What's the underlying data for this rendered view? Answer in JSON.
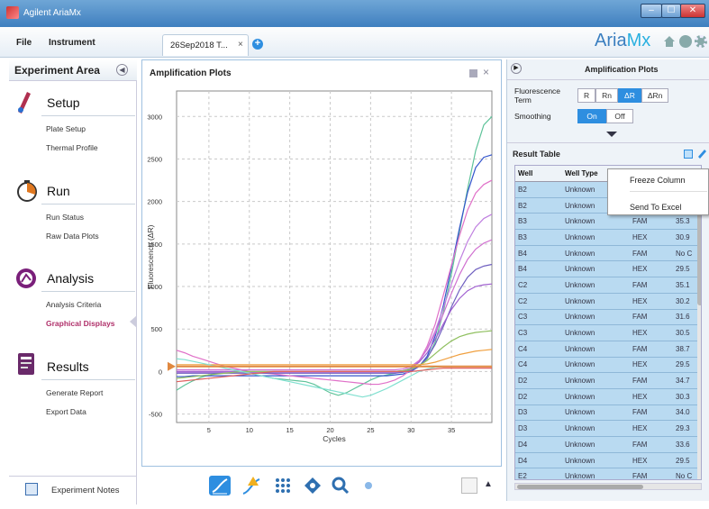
{
  "window": {
    "title": "Agilent AriaMx",
    "min": "–",
    "max": "☐",
    "close": "✕"
  },
  "menu": {
    "file": "File",
    "instrument": "Instrument"
  },
  "tab": {
    "label": "26Sep2018 T...",
    "close": "×",
    "add": "+"
  },
  "brand": {
    "aria": "Aria",
    "mx": "Mx"
  },
  "sidebar": {
    "title": "Experiment Area",
    "sections": [
      {
        "title": "Setup",
        "items": [
          "Plate Setup",
          "Thermal Profile"
        ]
      },
      {
        "title": "Run",
        "items": [
          "Run Status",
          "Raw Data Plots"
        ]
      },
      {
        "title": "Analysis",
        "items": [
          "Analysis Criteria",
          "Graphical Displays"
        ]
      },
      {
        "title": "Results",
        "items": [
          "Generate Report",
          "Export Data"
        ]
      }
    ],
    "notes": "Experiment Notes"
  },
  "chart_panel": {
    "title": "Amplification Plots"
  },
  "right_panel": {
    "title": "Amplification Plots",
    "fluor_label": "Fluorescence Term",
    "fluor_options": [
      "R",
      "Rn",
      "ΔR",
      "ΔRn"
    ],
    "fluor_selected": "ΔR",
    "smooth_label": "Smoothing",
    "smooth_options": [
      "On",
      "Off"
    ],
    "smooth_selected": "On",
    "result_table_title": "Result Table",
    "columns": [
      "Well",
      "Well Type",
      "",
      ""
    ],
    "rows": [
      [
        "B2",
        "Unknown",
        "",
        ""
      ],
      [
        "B2",
        "Unknown",
        "",
        ""
      ],
      [
        "B3",
        "Unknown",
        "FAM",
        "35.3"
      ],
      [
        "B3",
        "Unknown",
        "HEX",
        "30.9"
      ],
      [
        "B4",
        "Unknown",
        "FAM",
        "No C"
      ],
      [
        "B4",
        "Unknown",
        "HEX",
        "29.5"
      ],
      [
        "C2",
        "Unknown",
        "FAM",
        "35.1"
      ],
      [
        "C2",
        "Unknown",
        "HEX",
        "30.2"
      ],
      [
        "C3",
        "Unknown",
        "FAM",
        "31.6"
      ],
      [
        "C3",
        "Unknown",
        "HEX",
        "30.5"
      ],
      [
        "C4",
        "Unknown",
        "FAM",
        "38.7"
      ],
      [
        "C4",
        "Unknown",
        "HEX",
        "29.5"
      ],
      [
        "D2",
        "Unknown",
        "FAM",
        "34.7"
      ],
      [
        "D2",
        "Unknown",
        "HEX",
        "30.3"
      ],
      [
        "D3",
        "Unknown",
        "FAM",
        "34.0"
      ],
      [
        "D3",
        "Unknown",
        "HEX",
        "29.3"
      ],
      [
        "D4",
        "Unknown",
        "FAM",
        "33.6"
      ],
      [
        "D4",
        "Unknown",
        "HEX",
        "29.5"
      ],
      [
        "E2",
        "Unknown",
        "FAM",
        "No C"
      ]
    ]
  },
  "context_menu": {
    "items": [
      "Freeze Column",
      "Send To Excel"
    ]
  },
  "chart_data": {
    "type": "line",
    "xlabel": "Cycles",
    "ylabel": "Fluorescence (ΔR)",
    "xlim": [
      1,
      40
    ],
    "ylim": [
      -600,
      3300
    ],
    "xticks": [
      5,
      10,
      15,
      20,
      25,
      30,
      35
    ],
    "yticks": [
      -500,
      0,
      500,
      1000,
      1500,
      2000,
      2500,
      3000
    ],
    "grid": true,
    "series": [
      {
        "color": "#5fc39a",
        "values": [
          -220,
          -160,
          -110,
          -70,
          -40,
          -20,
          -10,
          0,
          0,
          -20,
          -40,
          -60,
          -80,
          -90,
          -100,
          -110,
          -120,
          -150,
          -200,
          -250,
          -280,
          -250,
          -200,
          -150,
          -100,
          -60,
          -40,
          -20,
          0,
          20,
          60,
          150,
          350,
          700,
          1150,
          1650,
          2150,
          2600,
          2900,
          3000
        ]
      },
      {
        "color": "#3355cc",
        "values": [
          -60,
          -60,
          -50,
          -50,
          -50,
          -50,
          -50,
          -50,
          -50,
          -50,
          -50,
          -50,
          -50,
          -50,
          -50,
          -50,
          -50,
          -50,
          -50,
          -50,
          -50,
          -50,
          -50,
          -50,
          -50,
          -50,
          -50,
          -40,
          -30,
          0,
          60,
          180,
          420,
          780,
          1230,
          1690,
          2110,
          2400,
          2520,
          2550
        ]
      },
      {
        "color": "#e070c8",
        "values": [
          250,
          220,
          180,
          150,
          120,
          90,
          60,
          40,
          20,
          0,
          -10,
          -20,
          -30,
          -40,
          -50,
          -60,
          -70,
          -80,
          -90,
          -100,
          -110,
          -120,
          -130,
          -140,
          -150,
          -150,
          -130,
          -100,
          -50,
          20,
          120,
          300,
          560,
          900,
          1250,
          1600,
          1900,
          2100,
          2200,
          2250
        ]
      },
      {
        "color": "#c080e0",
        "values": [
          -10,
          -10,
          -10,
          -10,
          -10,
          -10,
          -10,
          -10,
          -10,
          -10,
          -10,
          -10,
          -10,
          -10,
          -10,
          -10,
          -10,
          -10,
          -10,
          -10,
          -10,
          -10,
          -10,
          -10,
          -10,
          -10,
          -10,
          -10,
          0,
          40,
          120,
          270,
          480,
          750,
          1030,
          1300,
          1530,
          1700,
          1800,
          1850
        ]
      },
      {
        "color": "#d070d0",
        "values": [
          20,
          20,
          20,
          20,
          20,
          20,
          20,
          20,
          20,
          20,
          20,
          20,
          20,
          20,
          20,
          20,
          20,
          20,
          20,
          20,
          20,
          20,
          20,
          20,
          20,
          20,
          20,
          20,
          30,
          60,
          130,
          260,
          450,
          680,
          920,
          1140,
          1320,
          1440,
          1510,
          1550
        ]
      },
      {
        "color": "#7060c0",
        "values": [
          -20,
          -20,
          -20,
          -20,
          -20,
          -20,
          -20,
          -20,
          -20,
          -20,
          -20,
          -20,
          -20,
          -20,
          -20,
          -20,
          -20,
          -20,
          -20,
          -20,
          -20,
          -20,
          -20,
          -20,
          -20,
          -20,
          -20,
          -20,
          -10,
          10,
          60,
          160,
          320,
          530,
          760,
          960,
          1110,
          1200,
          1240,
          1260
        ]
      },
      {
        "color": "#a060d0",
        "values": [
          0,
          0,
          0,
          0,
          0,
          0,
          0,
          0,
          0,
          0,
          0,
          0,
          0,
          0,
          0,
          0,
          0,
          0,
          0,
          0,
          0,
          0,
          0,
          0,
          0,
          0,
          0,
          0,
          10,
          40,
          110,
          220,
          380,
          560,
          730,
          860,
          950,
          1000,
          1020,
          1030
        ]
      },
      {
        "color": "#90c060",
        "values": [
          -80,
          -70,
          -60,
          -50,
          -40,
          -30,
          -20,
          -10,
          0,
          0,
          0,
          0,
          0,
          0,
          0,
          0,
          0,
          0,
          0,
          0,
          0,
          0,
          0,
          0,
          0,
          0,
          0,
          0,
          10,
          30,
          70,
          130,
          210,
          290,
          360,
          410,
          440,
          460,
          470,
          480
        ]
      },
      {
        "color": "#f0a040",
        "values": [
          80,
          80,
          80,
          80,
          80,
          80,
          80,
          80,
          80,
          80,
          80,
          80,
          80,
          80,
          80,
          80,
          80,
          80,
          80,
          80,
          80,
          80,
          80,
          80,
          80,
          80,
          80,
          80,
          80,
          80,
          80,
          90,
          110,
          140,
          170,
          200,
          220,
          240,
          250,
          260
        ]
      },
      {
        "color": "#80e0d0",
        "values": [
          150,
          140,
          120,
          100,
          80,
          60,
          40,
          20,
          0,
          -20,
          -40,
          -60,
          -80,
          -100,
          -120,
          -140,
          -160,
          -180,
          -200,
          -220,
          -240,
          -260,
          -280,
          -300,
          -280,
          -240,
          -200,
          -150,
          -100,
          -50,
          0,
          30,
          50,
          60,
          60,
          60,
          60,
          60,
          60,
          60
        ]
      },
      {
        "color": "#e06060",
        "values": [
          -120,
          -110,
          -100,
          -90,
          -80,
          -70,
          -60,
          -50,
          -40,
          -30,
          -20,
          -10,
          0,
          0,
          0,
          0,
          0,
          0,
          0,
          0,
          0,
          0,
          0,
          0,
          0,
          0,
          0,
          0,
          0,
          0,
          10,
          20,
          30,
          40,
          40,
          40,
          40,
          40,
          40,
          40
        ]
      },
      {
        "color": "#c89050",
        "values": [
          60,
          60,
          60,
          60,
          60,
          60,
          60,
          60,
          60,
          60,
          60,
          60,
          60,
          60,
          60,
          60,
          60,
          60,
          60,
          60,
          60,
          60,
          60,
          60,
          60,
          60,
          60,
          60,
          60,
          60,
          60,
          60,
          60,
          60,
          60,
          60,
          60,
          60,
          60,
          60
        ]
      }
    ],
    "threshold": {
      "value": 60,
      "color": "#e08840"
    }
  }
}
